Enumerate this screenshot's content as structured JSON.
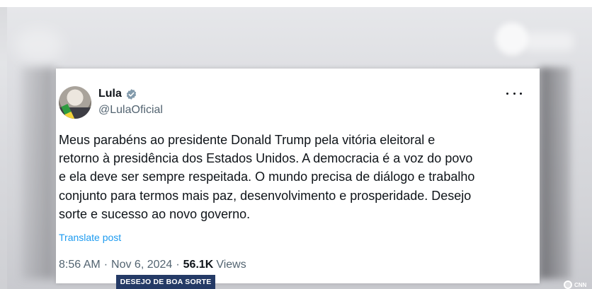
{
  "tweet": {
    "author_name": "Lula",
    "handle": "@LulaOficial",
    "text_lines": [
      "Meus parabéns ao presidente Donald Trump pela vitória eleitoral e",
      "retorno à presidência dos Estados Unidos. A democracia é a voz do povo",
      "e ela deve ser sempre respeitada. O mundo precisa de diálogo e trabalho",
      "conjunto para termos mais paz, desenvolvimento e prosperidade. Desejo",
      "sorte e sucesso ao novo governo."
    ],
    "translate_label": "Translate post",
    "time": "8:56 AM",
    "date": "Nov 6, 2024",
    "separator": "·",
    "views_count": "56.1K",
    "views_label": "Views",
    "verified_color": "#829aab"
  },
  "broadcast": {
    "lower_third": "DESEJO DE BOA SORTE",
    "lower_third_color": "#243a66",
    "watermark": "CNN"
  },
  "icons": {
    "verified": "verified-badge-icon",
    "more": "more-options-icon",
    "watermark": "channel-logo-icon"
  }
}
